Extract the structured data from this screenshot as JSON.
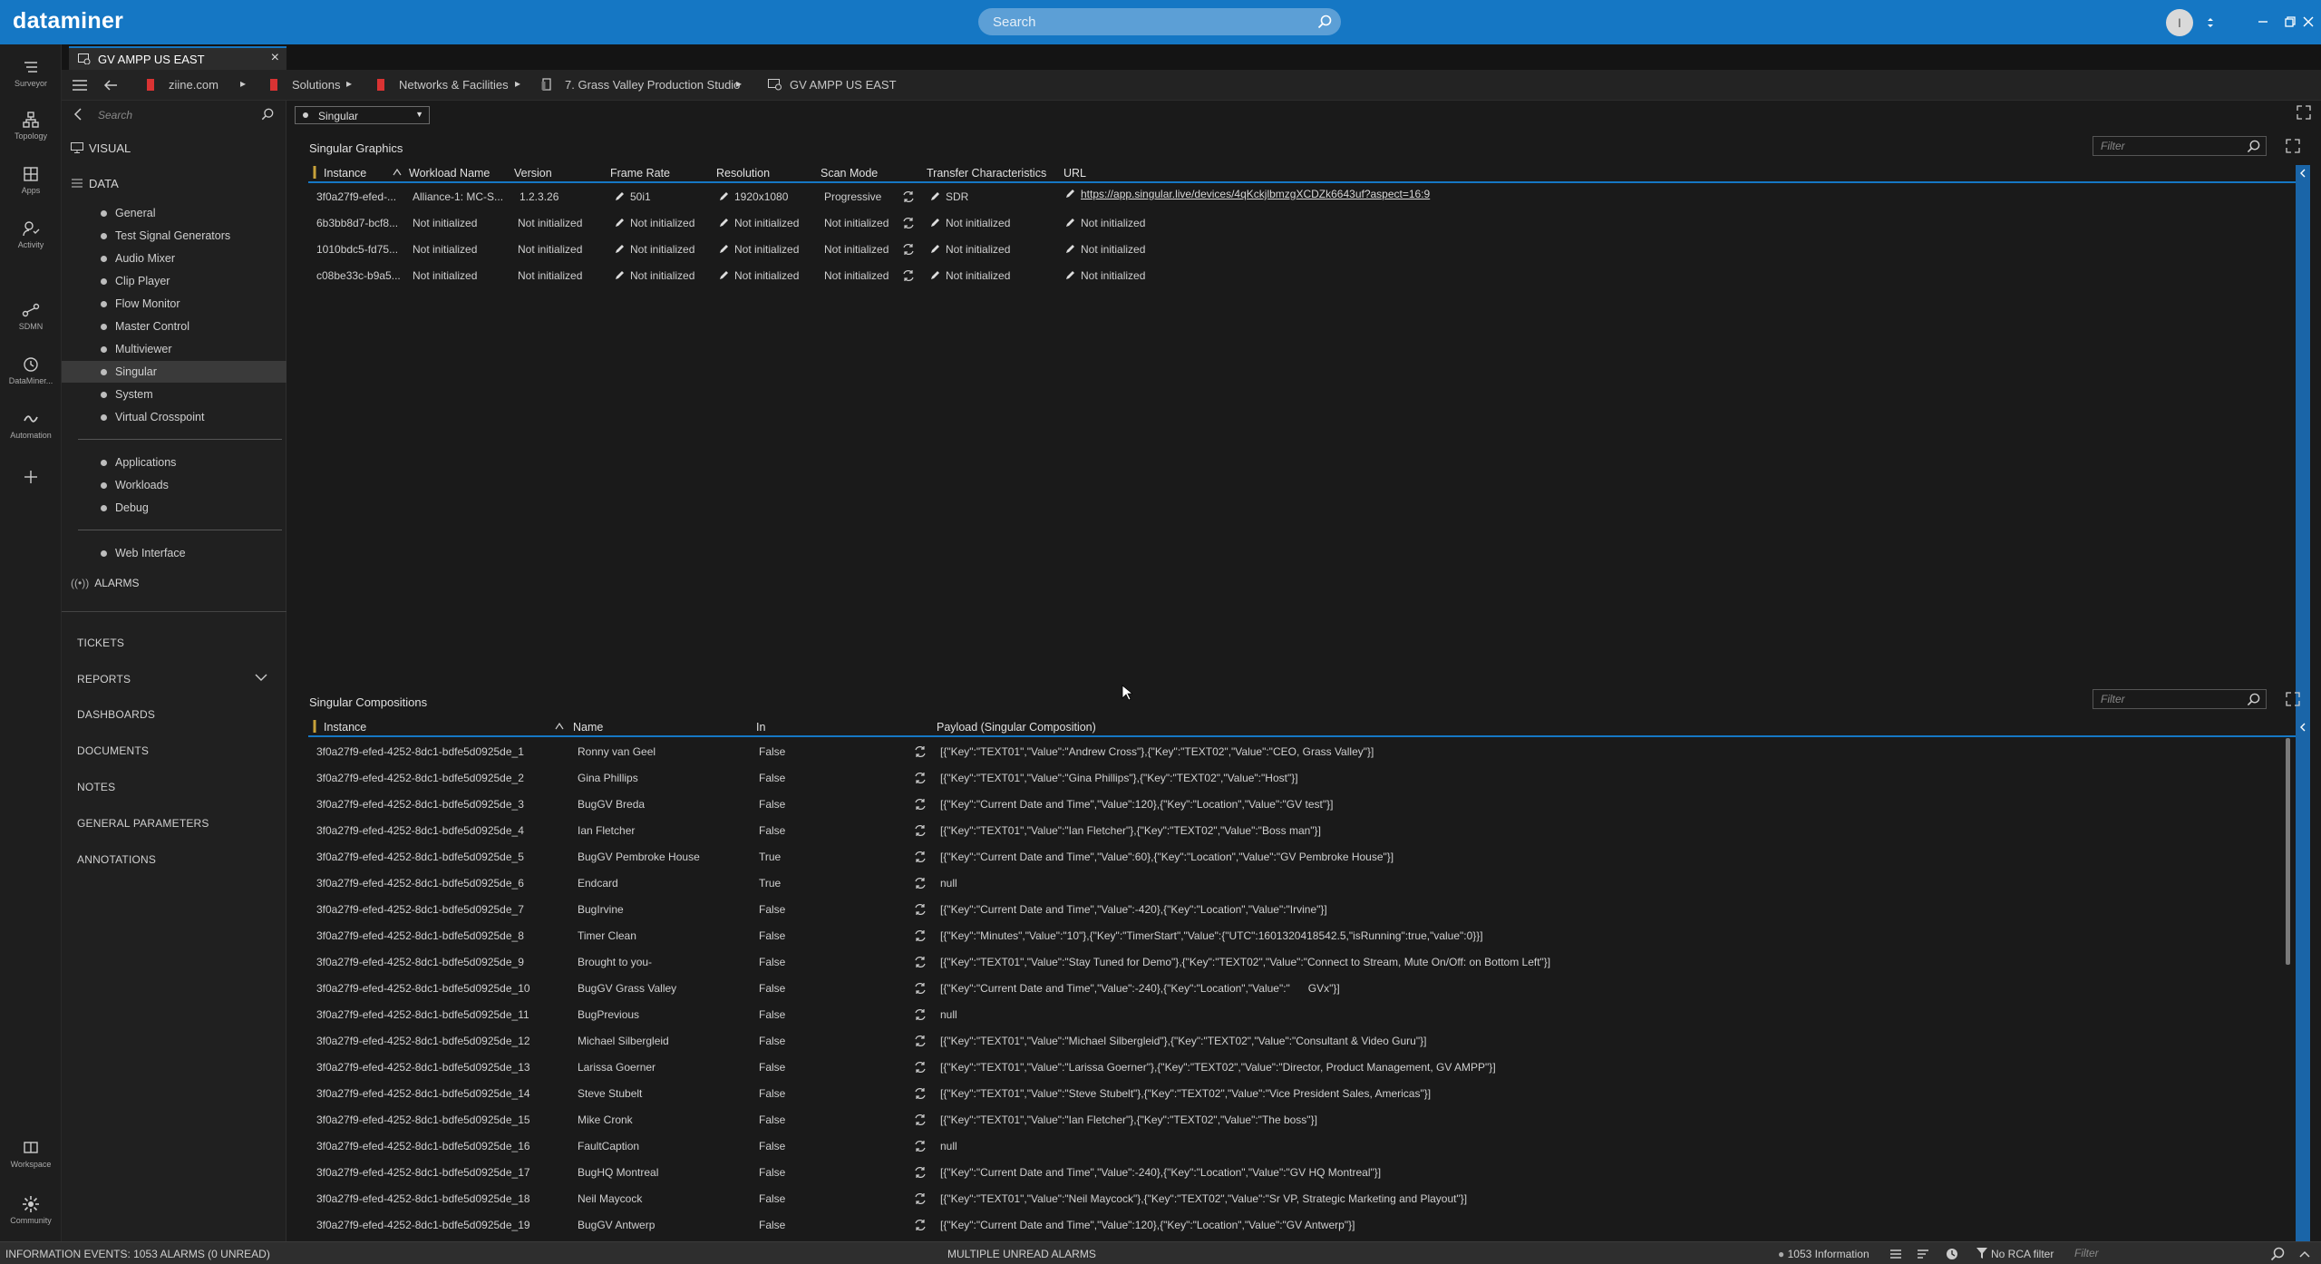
{
  "app": {
    "brand": "dataminer",
    "user_initial": "I",
    "search_placeholder": "Search"
  },
  "rail": [
    {
      "label": "Surveyor",
      "icon": "surveyor-icon"
    },
    {
      "label": "Topology",
      "icon": "topology-icon"
    },
    {
      "label": "Apps",
      "icon": "apps-icon"
    },
    {
      "label": "Activity",
      "icon": "activity-icon"
    },
    {
      "label": "SDMN",
      "icon": "sdmn-icon"
    },
    {
      "label": "DataMiner...",
      "icon": "dataminer-time-icon"
    },
    {
      "label": "Automation",
      "icon": "automation-icon"
    },
    {
      "label": "Workspace",
      "icon": "workspace-icon"
    },
    {
      "label": "Community",
      "icon": "community-icon"
    }
  ],
  "tab": {
    "label": "GV AMPP US EAST"
  },
  "breadcrumb": [
    "ziine.com",
    "Solutions",
    "Networks & Facilities",
    "7. Grass Valley Production Studio",
    "GV AMPP US EAST"
  ],
  "sidebar": {
    "search_placeholder": "Search",
    "visual": "VISUAL",
    "data": "DATA",
    "items": [
      "General",
      "Test Signal Generators",
      "Audio Mixer",
      "Clip Player",
      "Flow Monitor",
      "Master Control",
      "Multiviewer",
      "Singular",
      "System",
      "Virtual Crosspoint"
    ],
    "items2": [
      "Applications",
      "Workloads",
      "Debug"
    ],
    "items3": [
      "Web Interface"
    ],
    "alarms": "ALARMS",
    "sections": [
      "TICKETS",
      "REPORTS",
      "DASHBOARDS",
      "DOCUMENTS",
      "NOTES",
      "GENERAL PARAMETERS",
      "ANNOTATIONS"
    ]
  },
  "page_select": "Singular",
  "graphics": {
    "title": "Singular Graphics",
    "filter_placeholder": "Filter",
    "headers": [
      "Instance",
      "Workload Name",
      "Version",
      "Frame Rate",
      "Resolution",
      "Scan Mode",
      "Transfer Characteristics",
      "URL"
    ],
    "rows": [
      [
        "3f0a27f9-efed-...",
        "Alliance-1: MC-S...",
        "1.2.3.26",
        "50i1",
        "1920x1080",
        "Progressive",
        "SDR",
        "https://app.singular.live/devices/4qKckjlbmzgXCDZk6643uf?aspect=16:9"
      ],
      [
        "6b3bb8d7-bcf8...",
        "Not initialized",
        "Not initialized",
        "Not initialized",
        "Not initialized",
        "Not initialized",
        "Not initialized",
        "Not initialized"
      ],
      [
        "1010bdc5-fd75...",
        "Not initialized",
        "Not initialized",
        "Not initialized",
        "Not initialized",
        "Not initialized",
        "Not initialized",
        "Not initialized"
      ],
      [
        "c08be33c-b9a5...",
        "Not initialized",
        "Not initialized",
        "Not initialized",
        "Not initialized",
        "Not initialized",
        "Not initialized",
        "Not initialized"
      ]
    ]
  },
  "compositions": {
    "title": "Singular Compositions",
    "filter_placeholder": "Filter",
    "headers": [
      "Instance",
      "Name",
      "In",
      "Payload (Singular Composition)"
    ],
    "rows": [
      [
        "3f0a27f9-efed-4252-8dc1-bdfe5d0925de_1",
        "Ronny van Geel",
        "False",
        "[{\"Key\":\"TEXT01\",\"Value\":\"Andrew Cross\"},{\"Key\":\"TEXT02\",\"Value\":\"CEO, Grass Valley\"}]"
      ],
      [
        "3f0a27f9-efed-4252-8dc1-bdfe5d0925de_2",
        "Gina Phillips",
        "False",
        "[{\"Key\":\"TEXT01\",\"Value\":\"Gina Phillips\"},{\"Key\":\"TEXT02\",\"Value\":\"Host\"}]"
      ],
      [
        "3f0a27f9-efed-4252-8dc1-bdfe5d0925de_3",
        "BugGV Breda",
        "False",
        "[{\"Key\":\"Current Date and Time\",\"Value\":120},{\"Key\":\"Location\",\"Value\":\"GV test\"}]"
      ],
      [
        "3f0a27f9-efed-4252-8dc1-bdfe5d0925de_4",
        "Ian Fletcher",
        "False",
        "[{\"Key\":\"TEXT01\",\"Value\":\"Ian Fletcher\"},{\"Key\":\"TEXT02\",\"Value\":\"Boss man\"}]"
      ],
      [
        "3f0a27f9-efed-4252-8dc1-bdfe5d0925de_5",
        "BugGV Pembroke House",
        "True",
        "[{\"Key\":\"Current Date and Time\",\"Value\":60},{\"Key\":\"Location\",\"Value\":\"GV Pembroke House\"}]"
      ],
      [
        "3f0a27f9-efed-4252-8dc1-bdfe5d0925de_6",
        "Endcard",
        "True",
        "null"
      ],
      [
        "3f0a27f9-efed-4252-8dc1-bdfe5d0925de_7",
        "BugIrvine",
        "False",
        "[{\"Key\":\"Current Date and Time\",\"Value\":-420},{\"Key\":\"Location\",\"Value\":\"Irvine\"}]"
      ],
      [
        "3f0a27f9-efed-4252-8dc1-bdfe5d0925de_8",
        "Timer Clean",
        "False",
        "[{\"Key\":\"Minutes\",\"Value\":\"10\"},{\"Key\":\"TimerStart\",\"Value\":{\"UTC\":1601320418542.5,\"isRunning\":true,\"value\":0}}]"
      ],
      [
        "3f0a27f9-efed-4252-8dc1-bdfe5d0925de_9",
        "Brought to you-",
        "False",
        "[{\"Key\":\"TEXT01\",\"Value\":\"Stay Tuned for Demo\"},{\"Key\":\"TEXT02\",\"Value\":\"Connect to Stream, Mute On/Off: on Bottom Left\"}]"
      ],
      [
        "3f0a27f9-efed-4252-8dc1-bdfe5d0925de_10",
        "BugGV Grass Valley",
        "False",
        "[{\"Key\":\"Current Date and Time\",\"Value\":-240},{\"Key\":\"Location\",\"Value\":\"      GVx\"}]"
      ],
      [
        "3f0a27f9-efed-4252-8dc1-bdfe5d0925de_11",
        "BugPrevious",
        "False",
        "null"
      ],
      [
        "3f0a27f9-efed-4252-8dc1-bdfe5d0925de_12",
        "Michael Silbergleid",
        "False",
        "[{\"Key\":\"TEXT01\",\"Value\":\"Michael Silbergleid\"},{\"Key\":\"TEXT02\",\"Value\":\"Consultant & Video Guru\"}]"
      ],
      [
        "3f0a27f9-efed-4252-8dc1-bdfe5d0925de_13",
        "Larissa Goerner",
        "False",
        "[{\"Key\":\"TEXT01\",\"Value\":\"Larissa Goerner\"},{\"Key\":\"TEXT02\",\"Value\":\"Director, Product Management, GV AMPP\"}]"
      ],
      [
        "3f0a27f9-efed-4252-8dc1-bdfe5d0925de_14",
        "Steve Stubelt",
        "False",
        "[{\"Key\":\"TEXT01\",\"Value\":\"Steve Stubelt\"},{\"Key\":\"TEXT02\",\"Value\":\"Vice President Sales, Americas\"}]"
      ],
      [
        "3f0a27f9-efed-4252-8dc1-bdfe5d0925de_15",
        "Mike Cronk",
        "False",
        "[{\"Key\":\"TEXT01\",\"Value\":\"Ian Fletcher\"},{\"Key\":\"TEXT02\",\"Value\":\"The boss\"}]"
      ],
      [
        "3f0a27f9-efed-4252-8dc1-bdfe5d0925de_16",
        "FaultCaption",
        "False",
        "null"
      ],
      [
        "3f0a27f9-efed-4252-8dc1-bdfe5d0925de_17",
        "BugHQ Montreal",
        "False",
        "[{\"Key\":\"Current Date and Time\",\"Value\":-240},{\"Key\":\"Location\",\"Value\":\"GV HQ Montreal\"}]"
      ],
      [
        "3f0a27f9-efed-4252-8dc1-bdfe5d0925de_18",
        "Neil Maycock",
        "False",
        "[{\"Key\":\"TEXT01\",\"Value\":\"Neil Maycock\"},{\"Key\":\"TEXT02\",\"Value\":\"Sr VP, Strategic Marketing and Playout\"}]"
      ],
      [
        "3f0a27f9-efed-4252-8dc1-bdfe5d0925de_19",
        "BugGV Antwerp",
        "False",
        "[{\"Key\":\"Current Date and Time\",\"Value\":120},{\"Key\":\"Location\",\"Value\":\"GV Antwerp\"}]"
      ]
    ]
  },
  "status": {
    "left": "INFORMATION EVENTS: 1053 ALARMS (0 UNREAD)",
    "center": "MULTIPLE UNREAD ALARMS",
    "info": "1053 Information",
    "rca": "No RCA filter",
    "filter_placeholder": "Filter"
  },
  "colors": {
    "accent": "#1577c4",
    "brand_red": "#d93333",
    "bg": "#1a1a1a"
  }
}
